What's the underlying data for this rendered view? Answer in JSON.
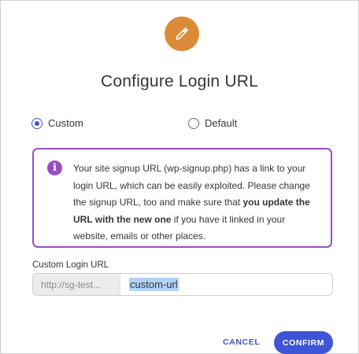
{
  "dialog": {
    "title": "Configure Login URL",
    "header_icon": "pencil-icon",
    "accent_color": "#dd8a37"
  },
  "options": {
    "custom_label": "Custom",
    "default_label": "Default",
    "selected": "Custom"
  },
  "notice": {
    "icon": "info-icon",
    "border_color": "#9a4cc7",
    "text_before": "Your site signup URL (wp-signup.php) has a link to your login URL, which can be easily exploited. Please change the signup URL, too and make sure that ",
    "text_bold": "you update the URL with the new one",
    "text_after": " if you have it linked in your website, emails or other places."
  },
  "field": {
    "label": "Custom Login URL",
    "prefix": "http://sg-test...",
    "value": "custom-url"
  },
  "actions": {
    "cancel_label": "CANCEL",
    "confirm_label": "CONFIRM",
    "primary_color": "#3e55d6"
  }
}
